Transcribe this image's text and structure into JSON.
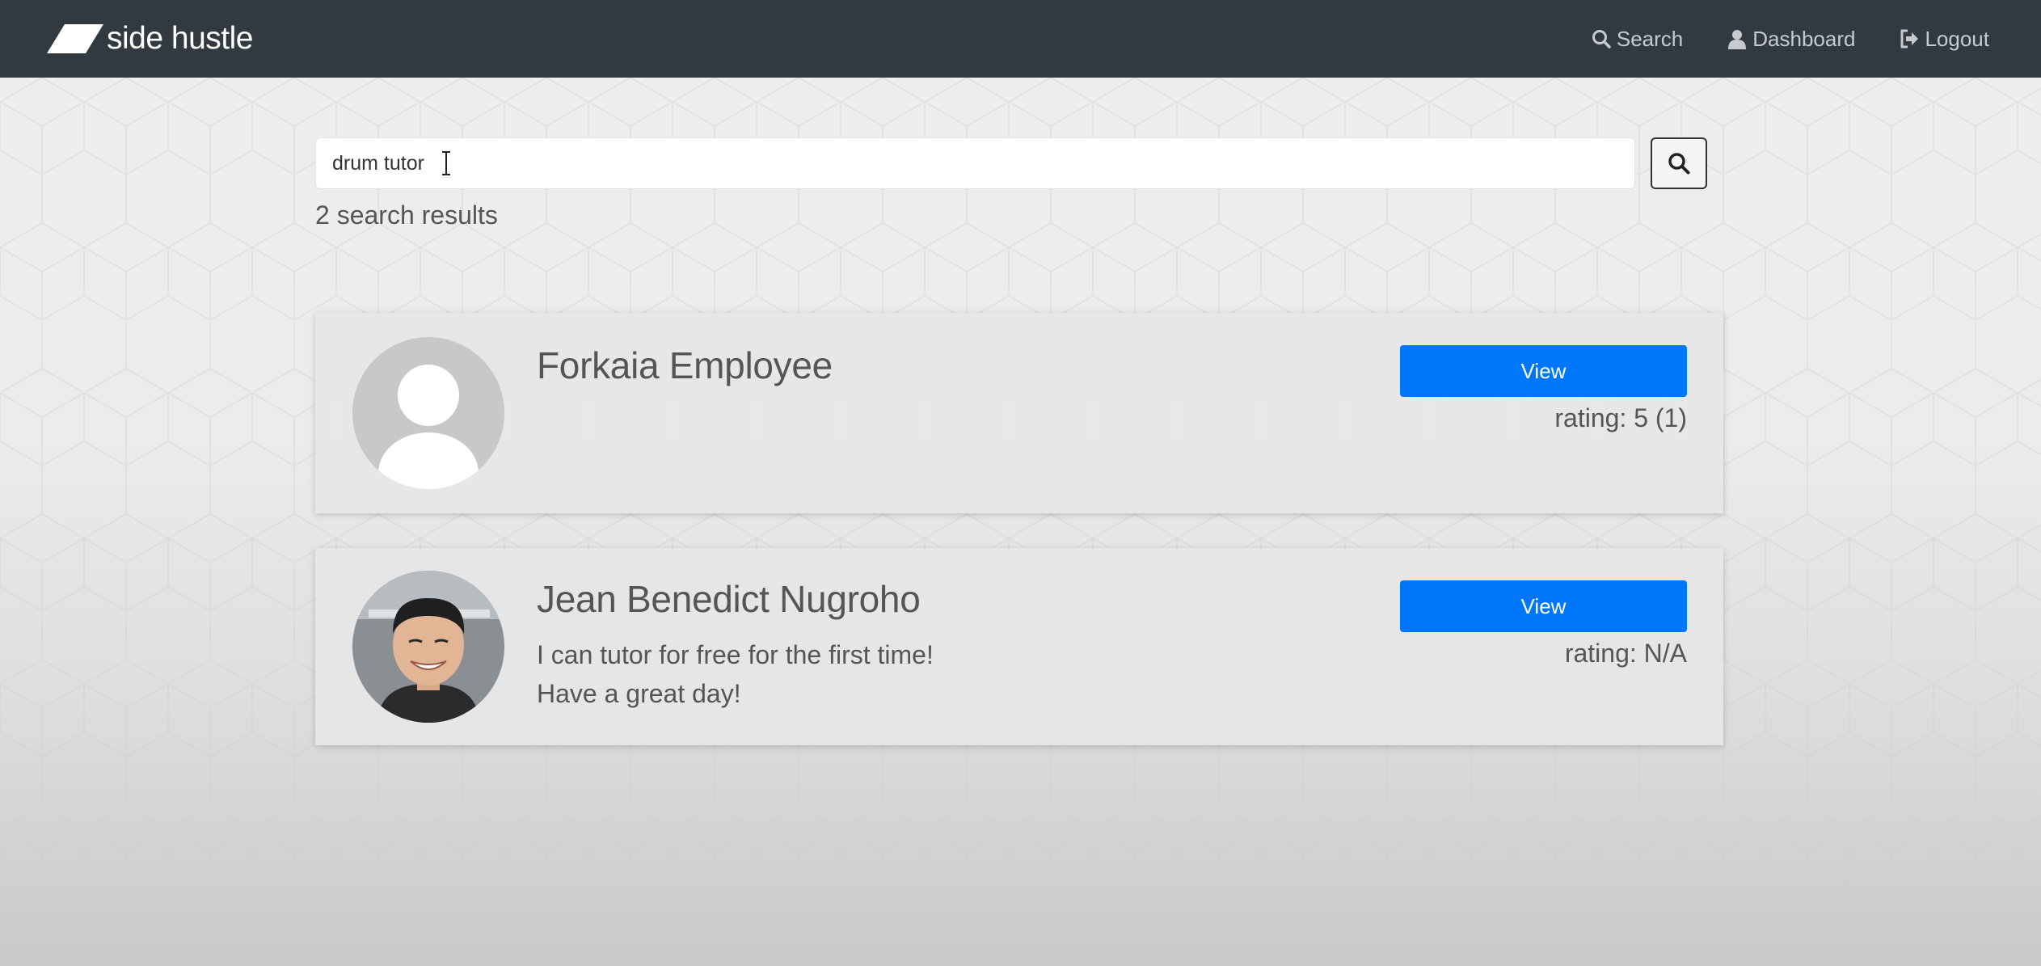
{
  "brand": {
    "name": "side hustle",
    "logo_icon": "parallelogram-logo-icon"
  },
  "nav": {
    "items": [
      {
        "label": "Search",
        "icon": "search-icon"
      },
      {
        "label": "Dashboard",
        "icon": "user-icon"
      },
      {
        "label": "Logout",
        "icon": "logout-icon"
      }
    ]
  },
  "search": {
    "value": "drum tutor",
    "button_icon": "search-icon",
    "results_count": "2 search results"
  },
  "results": [
    {
      "name": "Forkaia Employee",
      "bio": [],
      "avatar": "default-avatar-icon",
      "button_label": "View",
      "rating": "rating: 5 (1)"
    },
    {
      "name": "Jean Benedict Nugroho",
      "bio": [
        "I can tutor for free for the first time!",
        "Have a great day!"
      ],
      "avatar": "profile-photo",
      "button_label": "View",
      "rating": "rating: N/A"
    }
  ],
  "colors": {
    "navbar": "#313a41",
    "primary_button": "#0077fb",
    "text": "#555555"
  }
}
